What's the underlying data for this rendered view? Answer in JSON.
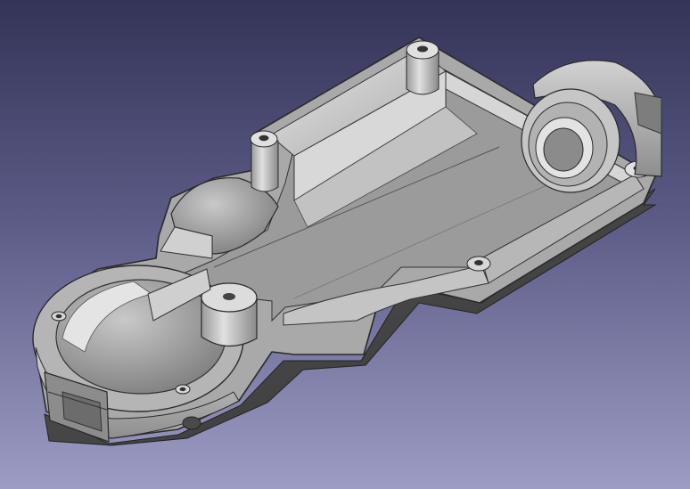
{
  "viewer": {
    "background_top": "#343458",
    "background_bottom": "#9c9cc4",
    "model_color": "#9a9a9a"
  },
  "model": {
    "shape": "enclosure-housing",
    "features": [
      "cavity-floor",
      "side-walls",
      "screw-bosses",
      "round-pocket",
      "cylindrical-boss",
      "bearing-seat",
      "end-openings"
    ]
  }
}
